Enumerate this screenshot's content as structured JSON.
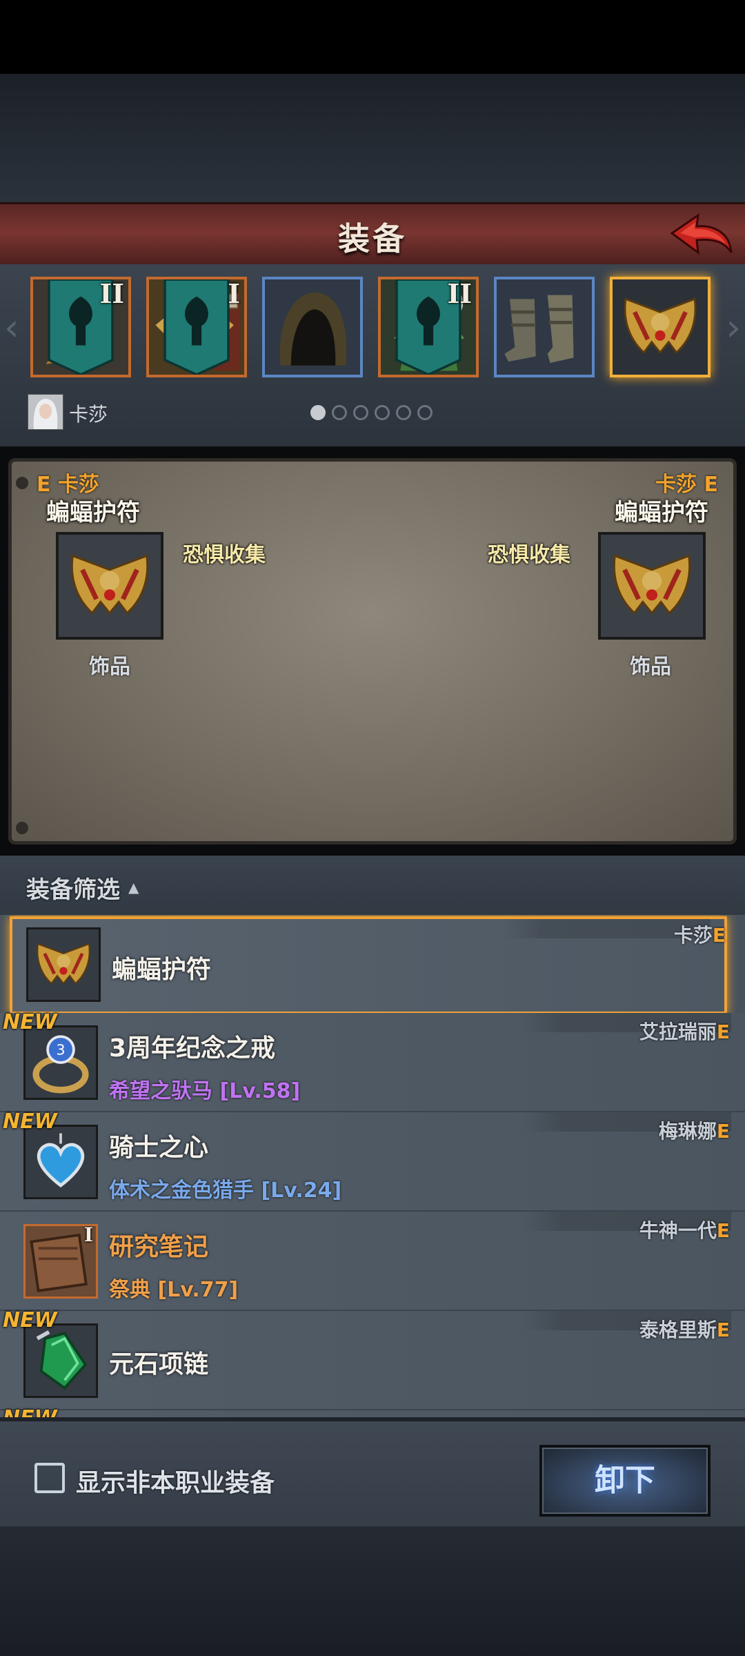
{
  "header": {
    "title": "装备"
  },
  "equipment_slots": [
    {
      "name": "weapon",
      "roman": "II",
      "banner": true,
      "frame": "orange"
    },
    {
      "name": "offhand",
      "roman": "I",
      "banner": true,
      "frame": "orange"
    },
    {
      "name": "helmet",
      "roman": "",
      "banner": false,
      "frame": "blue"
    },
    {
      "name": "armor",
      "roman": "II",
      "banner": true,
      "frame": "orange"
    },
    {
      "name": "boots",
      "roman": "",
      "banner": false,
      "frame": "blue"
    },
    {
      "name": "accessory",
      "roman": "",
      "banner": false,
      "frame": "selected"
    }
  ],
  "hero": {
    "name": "卡莎"
  },
  "pager": {
    "count": 6,
    "active": 0
  },
  "compare": {
    "left": {
      "hero": "E 卡莎",
      "item_name": "蝙蝠护符",
      "tag": "恐惧收集",
      "type": "饰品"
    },
    "right": {
      "hero": "卡莎 E",
      "item_name": "蝙蝠护符",
      "tag": "恐惧收集",
      "type": "饰品"
    }
  },
  "filter": {
    "label": "装备筛选",
    "caret": "▲"
  },
  "list": [
    {
      "title": "蝙蝠护符",
      "sub": "",
      "sub_color": "",
      "owner": "卡莎",
      "owner_suffix": "E",
      "is_new": false,
      "selected": true,
      "icon": "bat-amulet-icon"
    },
    {
      "title": "3周年纪念之戒",
      "sub": "希望之驮马 [Lv.58]",
      "sub_color": "#c073f2",
      "owner": "艾拉瑞丽",
      "owner_suffix": "E",
      "is_new": true,
      "selected": false,
      "icon": "ring-icon"
    },
    {
      "title": "骑士之心",
      "sub": "体术之金色猎手 [Lv.24]",
      "sub_color": "#7aa9ea",
      "owner": "梅琳娜",
      "owner_suffix": "E",
      "is_new": true,
      "selected": false,
      "icon": "heart-pendant-icon"
    },
    {
      "title": "研究笔记",
      "sub": "祭典 [Lv.77]",
      "sub_color": "#f0a04a",
      "owner": "牛神一代",
      "owner_suffix": "E",
      "is_new": false,
      "selected": false,
      "icon": "notebook-icon",
      "orange": true,
      "roman": "I"
    },
    {
      "title": "元石项链",
      "sub": "",
      "sub_color": "",
      "owner": "泰格里斯",
      "owner_suffix": "E",
      "is_new": true,
      "selected": false,
      "icon": "gem-necklace-icon"
    }
  ],
  "new_label": "NEW",
  "footer": {
    "checkbox_label": "显示非本职业装备",
    "unequip_label": "卸下"
  }
}
